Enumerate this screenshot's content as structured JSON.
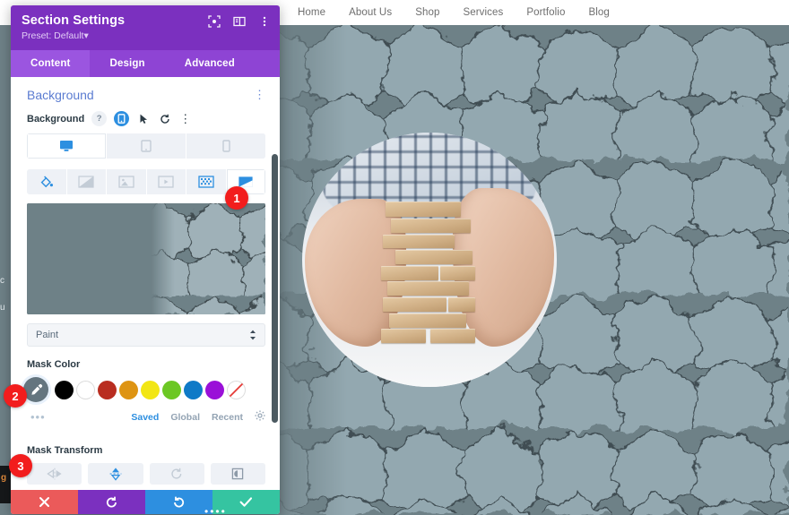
{
  "website": {
    "nav": [
      {
        "label": "Home"
      },
      {
        "label": "About Us"
      },
      {
        "label": "Shop"
      },
      {
        "label": "Services"
      },
      {
        "label": "Portfolio"
      },
      {
        "label": "Blog"
      }
    ],
    "hero_bg_color": "#6e8187",
    "hex_color": "#93a8b0",
    "sliver_text_1": "c",
    "sliver_text_2": "u",
    "sliver_text_3": "g"
  },
  "panel": {
    "title": "Section Settings",
    "preset": "Preset: Default",
    "preset_caret": "▾",
    "header_icons": [
      {
        "name": "focus-target-icon"
      },
      {
        "name": "panel-layout-icon"
      },
      {
        "name": "more-vertical-icon"
      }
    ],
    "tabs": [
      {
        "label": "Content",
        "active": true
      },
      {
        "label": "Design",
        "active": false
      },
      {
        "label": "Advanced",
        "active": false
      }
    ],
    "section": {
      "title": "Background",
      "menu_glyph": "⋮"
    },
    "background_field": {
      "label": "Background",
      "help_glyph": "?",
      "responsive_glyph": "□",
      "pointer_glyph": "➤",
      "reset_glyph": "↺",
      "more_glyph": "⋮"
    },
    "devices": [
      {
        "name": "desktop",
        "active": true
      },
      {
        "name": "tablet",
        "active": false
      },
      {
        "name": "phone",
        "active": false
      }
    ],
    "bg_types": [
      {
        "name": "color-fill",
        "active": false
      },
      {
        "name": "gradient",
        "active": false
      },
      {
        "name": "image",
        "active": false
      },
      {
        "name": "video",
        "active": false
      },
      {
        "name": "pattern",
        "active": false
      },
      {
        "name": "mask",
        "active": true
      }
    ],
    "mask_preview": {
      "pattern": "honeycomb",
      "color": "#6e8187",
      "accent": "#9fb1b8"
    },
    "paint_select": {
      "value": "Paint",
      "options": [
        "Paint"
      ]
    },
    "mask_color": {
      "label": "Mask Color",
      "eyedropper": "eyedropper-icon",
      "swatches": [
        {
          "name": "black",
          "hex": "#000000"
        },
        {
          "name": "white",
          "hex": "#ffffff"
        },
        {
          "name": "dark-red",
          "hex": "#b92d20"
        },
        {
          "name": "orange",
          "hex": "#de9413"
        },
        {
          "name": "yellow",
          "hex": "#f2e614"
        },
        {
          "name": "green",
          "hex": "#6cc724"
        },
        {
          "name": "blue",
          "hex": "#0f7ac7"
        },
        {
          "name": "purple",
          "hex": "#9a10d8"
        },
        {
          "name": "transparent",
          "hex": "transparent"
        }
      ],
      "more_glyph": "•••",
      "tabs": [
        {
          "label": "Saved",
          "active": true
        },
        {
          "label": "Global",
          "active": false
        },
        {
          "label": "Recent",
          "active": false
        }
      ],
      "settings_icon": "gear-icon"
    },
    "mask_transform": {
      "label": "Mask Transform",
      "buttons": [
        {
          "name": "flip-horizontal"
        },
        {
          "name": "flip-vertical"
        },
        {
          "name": "rotate"
        },
        {
          "name": "invert"
        }
      ]
    },
    "footer": [
      {
        "name": "cancel",
        "glyph": "✕",
        "color": "#eb5a5a"
      },
      {
        "name": "undo",
        "glyph": "↺",
        "color": "#7b30bf"
      },
      {
        "name": "redo",
        "glyph": "↻",
        "color": "#2d8fe0"
      },
      {
        "name": "save",
        "glyph": "✔",
        "color": "#35c4a1"
      }
    ],
    "drag_handle": "••••"
  },
  "callouts": [
    {
      "number": "1"
    },
    {
      "number": "2"
    },
    {
      "number": "3"
    }
  ]
}
